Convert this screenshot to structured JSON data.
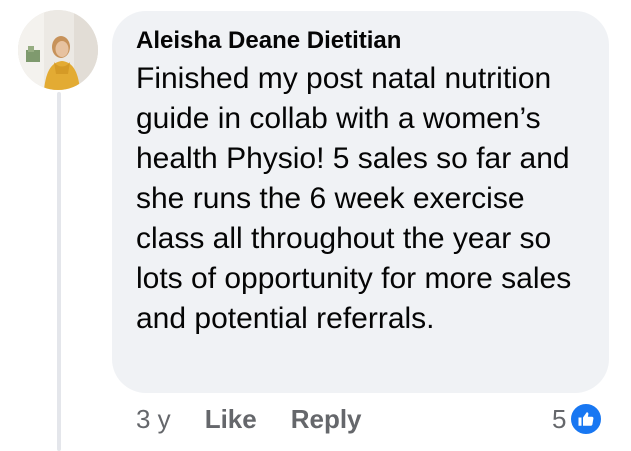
{
  "comment": {
    "author": "Aleisha Deane Dietitian",
    "text": "Finished my post natal nutrition guide in collab with a women’s health Physio! 5 sales so far and she runs the 6 week exercise class all throughout the year so lots of opportunity for more sales and potential referrals.",
    "avatar_icon": "profile-photo",
    "bubble_color": "#f0f2f5"
  },
  "footer": {
    "time": "3 y",
    "like_label": "Like",
    "reply_label": "Reply",
    "secondary_text_color": "#65676b"
  },
  "reactions": {
    "count": "5",
    "icon": "thumbs-up-icon",
    "badge_color": "#1877f2"
  }
}
